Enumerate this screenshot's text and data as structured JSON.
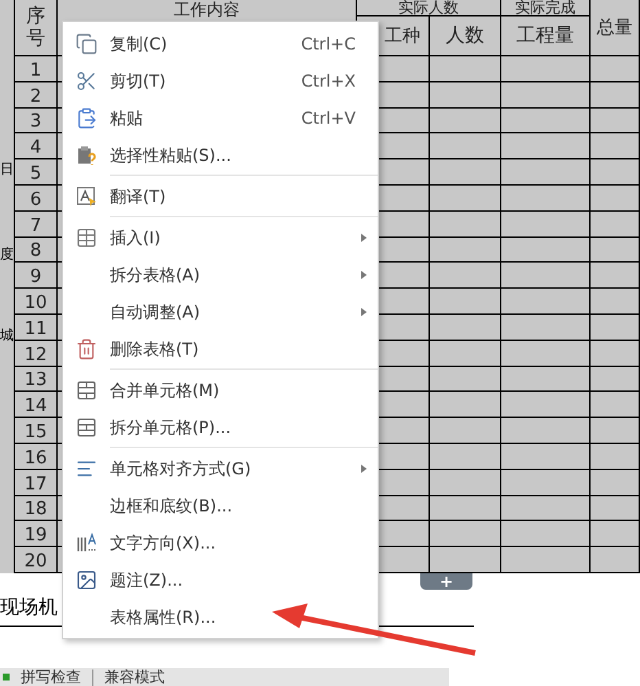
{
  "table": {
    "left_labels": [
      "日",
      "度",
      "城"
    ],
    "header": {
      "number": "序号",
      "content": "工作内容",
      "group_people": "实际人数",
      "group_done": "实际完成",
      "total": "总量",
      "trade": "工种",
      "people": "人数",
      "quantity": "工程量"
    },
    "rows": [
      "1",
      "2",
      "3",
      "4",
      "5",
      "6",
      "7",
      "8",
      "9",
      "10",
      "11",
      "12",
      "13",
      "14",
      "15",
      "16",
      "17",
      "18",
      "19",
      "20"
    ]
  },
  "add_row_button": "+",
  "below_text": "现场机",
  "context_menu": {
    "items": [
      {
        "label": "复制(C)",
        "shortcut": "Ctrl+C",
        "submenu": false,
        "separator_after": false
      },
      {
        "label": "剪切(T)",
        "shortcut": "Ctrl+X",
        "submenu": false,
        "separator_after": false
      },
      {
        "label": "粘贴",
        "shortcut": "Ctrl+V",
        "submenu": false,
        "separator_after": false
      },
      {
        "label": "选择性粘贴(S)...",
        "submenu": false,
        "separator_after": true
      },
      {
        "label": "翻译(T)",
        "submenu": false,
        "separator_after": true
      },
      {
        "label": "插入(I)",
        "submenu": true,
        "separator_after": false
      },
      {
        "label": "拆分表格(A)",
        "submenu": true,
        "separator_after": false
      },
      {
        "label": "自动调整(A)",
        "submenu": true,
        "separator_after": false
      },
      {
        "label": "删除表格(T)",
        "submenu": false,
        "separator_after": true
      },
      {
        "label": "合并单元格(M)",
        "submenu": false,
        "separator_after": false
      },
      {
        "label": "拆分单元格(P)...",
        "submenu": false,
        "separator_after": true
      },
      {
        "label": "单元格对齐方式(G)",
        "submenu": true,
        "separator_after": false
      },
      {
        "label": "边框和底纹(B)...",
        "submenu": false,
        "separator_after": false
      },
      {
        "label": "文字方向(X)...",
        "submenu": false,
        "separator_after": false
      },
      {
        "label": "题注(Z)...",
        "submenu": false,
        "separator_after": false
      },
      {
        "label": "表格属性(R)...",
        "submenu": false,
        "separator_after": false
      }
    ]
  },
  "status_bar": [
    "拼写检查",
    "兼容模式"
  ]
}
